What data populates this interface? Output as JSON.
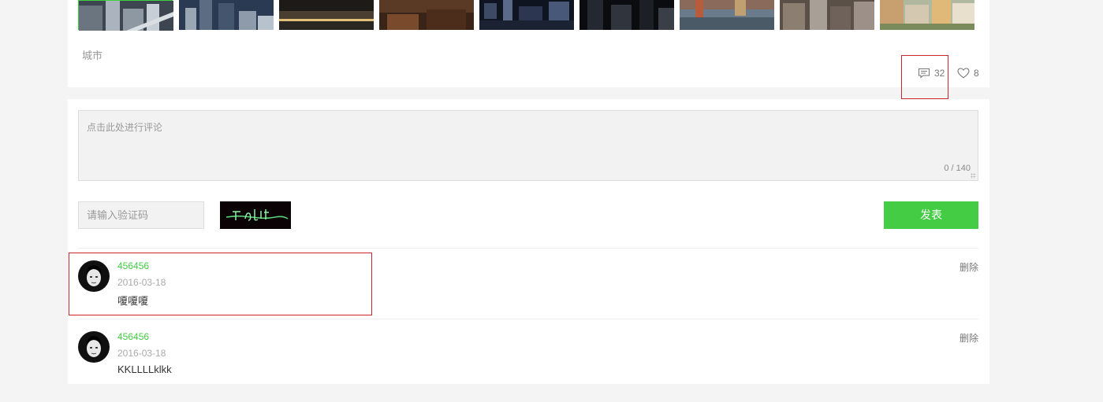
{
  "post": {
    "tag": "城市",
    "comments_count": "32",
    "likes_count": "8",
    "thumbnails": [
      {
        "name": "photo-1",
        "selected": true
      },
      {
        "name": "photo-2"
      },
      {
        "name": "photo-3"
      },
      {
        "name": "photo-4"
      },
      {
        "name": "photo-5"
      },
      {
        "name": "photo-6"
      },
      {
        "name": "photo-7"
      },
      {
        "name": "photo-8"
      },
      {
        "name": "photo-9"
      }
    ]
  },
  "comment_form": {
    "placeholder": "点击此处进行评论",
    "char_count": "0 / 140",
    "captcha_placeholder": "请输入验证码",
    "submit_label": "发表"
  },
  "comments": [
    {
      "user": "456456",
      "date": "2016-03-18",
      "text": "嗄嗄嗄",
      "delete_label": "删除"
    },
    {
      "user": "456456",
      "date": "2016-03-18",
      "text": "KKLLLLklkk",
      "delete_label": "删除"
    }
  ],
  "colors": {
    "accent": "#44cc44",
    "highlight": "#c9252b"
  },
  "icons": {
    "comment": "comment-bubble-icon",
    "like": "heart-icon"
  }
}
